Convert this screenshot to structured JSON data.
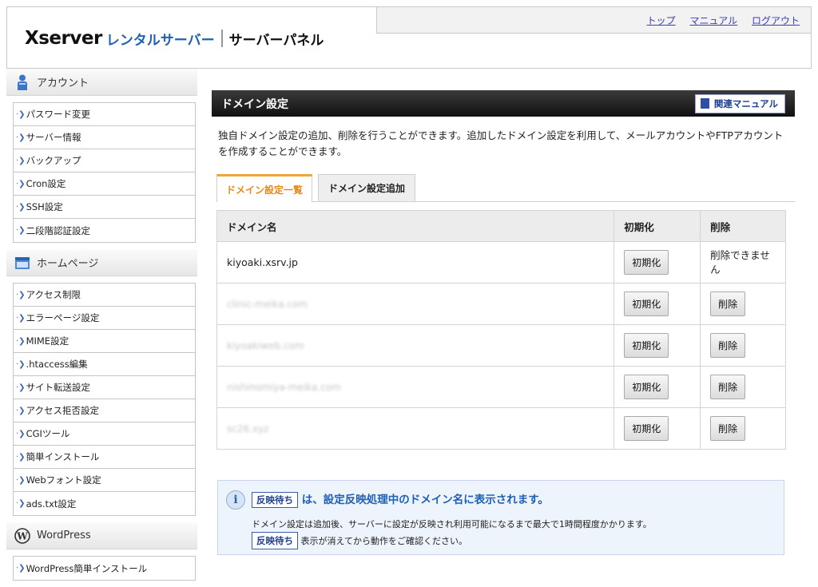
{
  "header": {
    "logo_main": "Xserver",
    "logo_sub": "レンタルサーバー",
    "logo_panel": "サーバーパネル",
    "links": [
      "トップ",
      "マニュアル",
      "ログアウト"
    ]
  },
  "sidebar": {
    "sections": [
      {
        "title": "アカウント",
        "icon": "person-icon",
        "items": [
          "パスワード変更",
          "サーバー情報",
          "バックアップ",
          "Cron設定",
          "SSH設定",
          "二段階認証設定"
        ]
      },
      {
        "title": "ホームページ",
        "icon": "homepage-icon",
        "items": [
          "アクセス制限",
          "エラーページ設定",
          "MIME設定",
          ".htaccess編集",
          "サイト転送設定",
          "アクセス拒否設定",
          "CGIツール",
          "簡単インストール",
          "Webフォント設定",
          "ads.txt設定"
        ]
      },
      {
        "title": "WordPress",
        "icon": "wordpress-icon",
        "items": [
          "WordPress簡単インストール"
        ]
      }
    ]
  },
  "main": {
    "title": "ドメイン設定",
    "manual_button": "関連マニュアル",
    "description": "独自ドメイン設定の追加、削除を行うことができます。追加したドメイン設定を利用して、メールアカウントやFTPアカウントを作成することができます。",
    "tabs": [
      "ドメイン設定一覧",
      "ドメイン設定追加"
    ],
    "table": {
      "headers": [
        "ドメイン名",
        "初期化",
        "削除"
      ],
      "rows": [
        {
          "domain": "kiyoaki.xsrv.jp",
          "init": "初期化",
          "delete": "削除できません"
        },
        {
          "domain": "clinic-meika.com",
          "init": "初期化",
          "delete": "削除"
        },
        {
          "domain": "kiyoakiweb.com",
          "init": "初期化",
          "delete": "削除"
        },
        {
          "domain": "nishinomiya-meika.com",
          "init": "初期化",
          "delete": "削除"
        },
        {
          "domain": "sc26.xyz",
          "init": "初期化",
          "delete": "削除"
        }
      ]
    },
    "info": {
      "badge": "反映待ち",
      "title_rest": "は、設定反映処理中のドメイン名に表示されます。",
      "line1": "ドメイン設定は追加後、サーバーに設定が反映され利用可能になるまで最大で1時間程度かかります。",
      "line2_rest": "表示が消えてから動作をご確認ください。"
    }
  },
  "colors": {
    "accent_orange": "#e88a1a",
    "link_blue": "#3d3db5",
    "brand_blue": "#1f5fb5"
  }
}
